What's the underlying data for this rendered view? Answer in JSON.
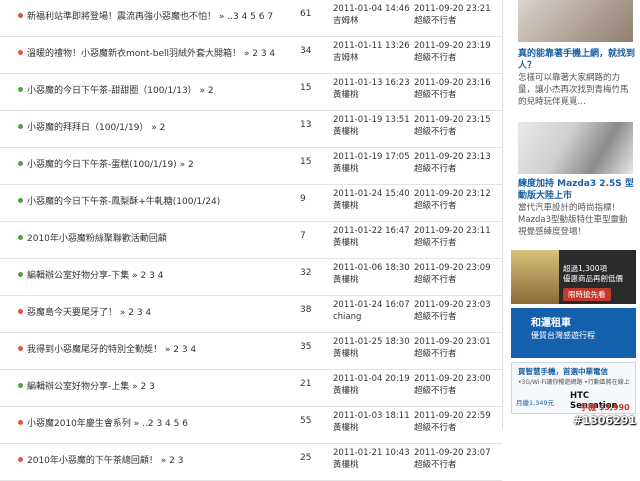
{
  "colors": {
    "dot_red": "#e5533d",
    "dot_green": "#4ca33d",
    "link_blue": "#1a5fa0"
  },
  "rows": [
    {
      "dot": "#e5533d",
      "title": "新福利站準即將登場！震流再強小惡魔也不怕！",
      "pages": "» ..3 4 5 6 7",
      "count": "61",
      "created_date": "2011-01-04 14:46",
      "created_by": "吉姆林",
      "updated_date": "2011-09-20 23:21",
      "updated_by": "超級不行者"
    },
    {
      "dot": "#e5533d",
      "title": "溫暖的禮物！小惡魔新衣mont-bell羽絨外套大開箱！",
      "pages": "» 2 3 4",
      "count": "34",
      "created_date": "2011-01-11 13:26",
      "created_by": "吉姆林",
      "updated_date": "2011-09-20 23:19",
      "updated_by": "超級不行者"
    },
    {
      "dot": "#4ca33d",
      "title": "小惡魔的今日下午茶-甜甜圈（100/1/13）",
      "pages": "» 2",
      "count": "15",
      "created_date": "2011-01-13 16:23",
      "created_by": "黃樓桃",
      "updated_date": "2011-09-20 23:16",
      "updated_by": "超級不行者"
    },
    {
      "dot": "#4ca33d",
      "title": "小惡魔的拜拜日（100/1/19）",
      "pages": "» 2",
      "count": "13",
      "created_date": "2011-01-19 13:51",
      "created_by": "黃樓桃",
      "updated_date": "2011-09-20 23:15",
      "updated_by": "超級不行者"
    },
    {
      "dot": "#4ca33d",
      "title": "小惡魔的今日下午茶-蛋糕(100/1/19)",
      "pages": "» 2",
      "count": "15",
      "created_date": "2011-01-19 17:05",
      "created_by": "黃樓桃",
      "updated_date": "2011-09-20 23:13",
      "updated_by": "超級不行者"
    },
    {
      "dot": "#4ca33d",
      "title": "小惡魔的今日下午茶-鳳梨酥+牛軋糖(100/1/24)",
      "pages": "",
      "count": "9",
      "created_date": "2011-01-24 15:40",
      "created_by": "黃樓桃",
      "updated_date": "2011-09-20 23:12",
      "updated_by": "超級不行者"
    },
    {
      "dot": "#4ca33d",
      "title": "2010年小惡魔粉絲聚聯歡活動回顧",
      "pages": "",
      "count": "7",
      "created_date": "2011-01-22 16:47",
      "created_by": "黃樓桃",
      "updated_date": "2011-09-20 23:11",
      "updated_by": "超級不行者"
    },
    {
      "dot": "#4ca33d",
      "title": "編輯辦公室好物分享-下集",
      "pages": "» 2 3 4",
      "count": "32",
      "created_date": "2011-01-06 18:30",
      "created_by": "黃樓桃",
      "updated_date": "2011-09-20 23:09",
      "updated_by": "超級不行者"
    },
    {
      "dot": "#e5533d",
      "title": "惡魔島今天要尾牙了！",
      "pages": "» 2 3 4",
      "count": "38",
      "created_date": "2011-01-24 16:07",
      "created_by": "chiang",
      "updated_date": "2011-09-20 23:03",
      "updated_by": "超級不行者"
    },
    {
      "dot": "#e5533d",
      "title": "我得到小惡魔尾牙的特別全勤獎！",
      "pages": "» 2 3 4",
      "count": "35",
      "created_date": "2011-01-25 18:30",
      "created_by": "黃樓桃",
      "updated_date": "2011-09-20 23:01",
      "updated_by": "超級不行者"
    },
    {
      "dot": "#4ca33d",
      "title": "編輯辦公室好物分享-上集",
      "pages": "» 2 3",
      "count": "21",
      "created_date": "2011-01-04 20:19",
      "created_by": "黃樓桃",
      "updated_date": "2011-09-20 23:00",
      "updated_by": "超級不行者"
    },
    {
      "dot": "#e5533d",
      "title": "小惡魔2010年慶生會系列",
      "pages": "» ..2 3 4 5 6",
      "count": "55",
      "created_date": "2011-01-03 18:11",
      "created_by": "黃樓桃",
      "updated_date": "2011-09-20 22:59",
      "updated_by": "超級不行者"
    },
    {
      "dot": "#e5533d",
      "title": "2010年小惡魔的下午茶總回顧！",
      "pages": "» 2 3",
      "count": "25",
      "created_date": "2011-01-21 10:43",
      "created_by": "黃樓桃",
      "updated_date": "2011-09-20 23:07",
      "updated_by": "超級不行者"
    }
  ],
  "sidebar": {
    "item1_title": "真的能靠著手機上網，就找到人？",
    "item1_desc": "怎樣可以靠著大家網路的力量，讓小杰再次找到青梅竹馬的兒時玩伴覓覓…",
    "item2_title": "練度加持 Mazda3 2.5S 型動版大陸上市",
    "item2_desc": "當代汽車設計的時尚指標！Mazda3型動版特仕車型靈動視覺感練度登場！",
    "ad1_text": "超過1,300項\n優惠商品再創低價",
    "ad1_button": "限時搶先看",
    "ad2_logo": "和運租車",
    "ad2_sub": "優質台灣感遊行程",
    "ad3_line1": "買智慧手機，首選中華電信",
    "ad3_line2": "•3G/Wi-Fi讓你暢遊網路 •行動區將在線上",
    "ad3_price": "月繳1,349元",
    "ad3_model": "HTC Sensation",
    "ad3_model_price": "手機 $3,990",
    "watermark": "#1306291"
  }
}
